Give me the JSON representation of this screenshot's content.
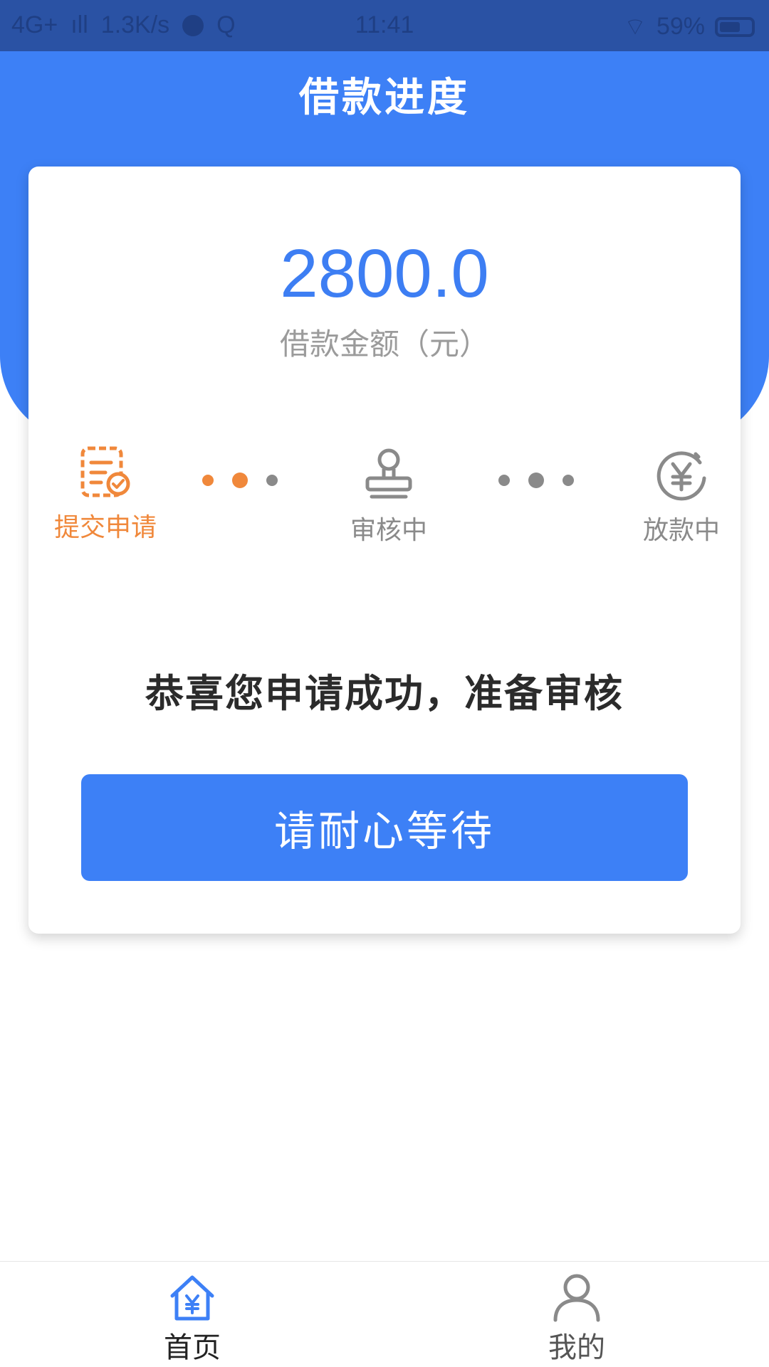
{
  "status_bar": {
    "network": "4G+",
    "speed": "1.3K/s",
    "time": "11:41",
    "battery": "59%"
  },
  "header": {
    "title": "借款进度"
  },
  "loan": {
    "amount": "2800.0",
    "amount_label": "借款金额（元）"
  },
  "steps": [
    {
      "label": "提交申请",
      "icon": "document-check-icon",
      "status": "active"
    },
    {
      "label": "审核中",
      "icon": "stamp-icon",
      "status": "pending"
    },
    {
      "label": "放款中",
      "icon": "yuan-coin-icon",
      "status": "pending"
    }
  ],
  "message": "恭喜您申请成功，准备审核",
  "action": {
    "button_label": "请耐心等待"
  },
  "tabbar": {
    "tabs": [
      {
        "label": "首页",
        "icon": "home-yuan-icon",
        "active": true
      },
      {
        "label": "我的",
        "icon": "user-icon",
        "active": false
      }
    ]
  },
  "colors": {
    "primary": "#3d80f6",
    "active_step": "#f0883b",
    "inactive": "#8a8a8a",
    "status_bar": "#2a52a4"
  }
}
